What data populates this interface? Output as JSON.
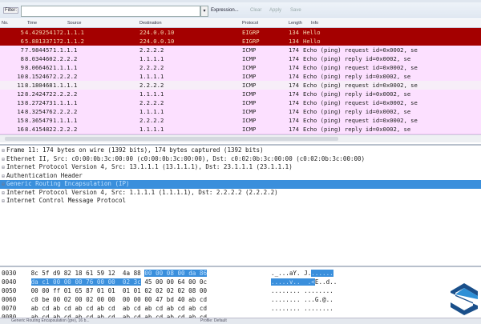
{
  "toolbar": {
    "filter_label": "Filter:",
    "filter_value": "",
    "expression": "Expression...",
    "clear": "Clear",
    "apply": "Apply",
    "save": "Save"
  },
  "columns": {
    "no": "No.",
    "time": "Time",
    "source": "Source",
    "destination": "Destination",
    "protocol": "Protocol",
    "length": "Length",
    "info": "Info"
  },
  "packets": [
    {
      "no": "5",
      "time": "4.429254",
      "src": "172.1.1.1",
      "dst": "224.0.0.10",
      "proto": "EIGRP",
      "len": "134",
      "info": "Hello",
      "type": "eigrp"
    },
    {
      "no": "6",
      "time": "5.881337",
      "src": "172.1.1.2",
      "dst": "224.0.0.10",
      "proto": "EIGRP",
      "len": "134",
      "info": "Hello",
      "type": "eigrp"
    },
    {
      "no": "7",
      "time": "7.984457",
      "src": "1.1.1.1",
      "dst": "2.2.2.2",
      "proto": "ICMP",
      "len": "174",
      "info": "Echo (ping) request  id=0x0002, se",
      "type": "icmp"
    },
    {
      "no": "8",
      "time": "8.034460",
      "src": "2.2.2.2",
      "dst": "1.1.1.1",
      "proto": "ICMP",
      "len": "174",
      "info": "Echo (ping) reply    id=0x0002, se",
      "type": "icmp"
    },
    {
      "no": "9",
      "time": "8.066462",
      "src": "1.1.1.1",
      "dst": "2.2.2.2",
      "proto": "ICMP",
      "len": "174",
      "info": "Echo (ping) request  id=0x0002, se",
      "type": "icmp"
    },
    {
      "no": "10",
      "time": "8.152467",
      "src": "2.2.2.2",
      "dst": "1.1.1.1",
      "proto": "ICMP",
      "len": "174",
      "info": "Echo (ping) reply    id=0x0002, se",
      "type": "icmp"
    },
    {
      "no": "11",
      "time": "8.180468",
      "src": "1.1.1.1",
      "dst": "2.2.2.2",
      "proto": "ICMP",
      "len": "174",
      "info": "Echo (ping) request  id=0x0002, se",
      "type": "sel"
    },
    {
      "no": "12",
      "time": "8.242472",
      "src": "2.2.2.2",
      "dst": "1.1.1.1",
      "proto": "ICMP",
      "len": "174",
      "info": "Echo (ping) reply    id=0x0002, se",
      "type": "icmp"
    },
    {
      "no": "13",
      "time": "8.272473",
      "src": "1.1.1.1",
      "dst": "2.2.2.2",
      "proto": "ICMP",
      "len": "174",
      "info": "Echo (ping) request  id=0x0002, se",
      "type": "icmp"
    },
    {
      "no": "14",
      "time": "8.325476",
      "src": "2.2.2.2",
      "dst": "1.1.1.1",
      "proto": "ICMP",
      "len": "174",
      "info": "Echo (ping) reply    id=0x0002, se",
      "type": "icmp"
    },
    {
      "no": "15",
      "time": "8.365479",
      "src": "1.1.1.1",
      "dst": "2.2.2.2",
      "proto": "ICMP",
      "len": "174",
      "info": "Echo (ping) request  id=0x0002, se",
      "type": "icmp"
    },
    {
      "no": "16",
      "time": "8.415482",
      "src": "2.2.2.2",
      "dst": "1.1.1.1",
      "proto": "ICMP",
      "len": "174",
      "info": "Echo (ping) reply    id=0x0002, se",
      "type": "icmp"
    }
  ],
  "details": [
    "Frame 11: 174 bytes on wire (1392 bits), 174 bytes captured (1392 bits)",
    "Ethernet II, Src: c0:00:0b:3c:00:00 (c0:00:0b:3c:00:00), Dst: c0:02:0b:3c:00:00 (c0:02:0b:3c:00:00)",
    "Internet Protocol Version 4, Src: 13.1.1.1 (13.1.1.1), Dst: 23.1.1.1 (23.1.1.1)",
    "Authentication Header",
    "Generic Routing Encapsulation (IP)",
    "Internet Protocol Version 4, Src: 1.1.1.1 (1.1.1.1), Dst: 2.2.2.2 (2.2.2.2)",
    "Internet Control Message Protocol"
  ],
  "selected_detail": 4,
  "hex": [
    {
      "off": "0030",
      "a": "8c 5f d9 82 18 61 59 12  4a 88 ",
      "h1": "00 00 08 00 da 86",
      "ascii_a": "._...aY. J.",
      "ascii_h": "......"
    },
    {
      "off": "0040",
      "h0": "da c1 00 00 00 76 00 00  02 3c",
      "b": " 45 00 00 64 00 0c",
      "ascii_h0": ".....v..  .<",
      "ascii_b": "E..d.."
    },
    {
      "off": "0050",
      "b": "00 00 ff 01 65 87 01 01  01 01 02 02 02 02 08 00",
      "ascii_b": "........ ........"
    },
    {
      "off": "0060",
      "b": "c0 be 00 02 00 02 00 00  00 00 00 47 bd 40 ab cd",
      "ascii_b": "........ ...G.@.."
    },
    {
      "off": "0070",
      "b": "ab cd ab cd ab cd ab cd  ab cd ab cd ab cd ab cd",
      "ascii_b": "........ ........"
    },
    {
      "off": "0080",
      "b": "ab cd ab cd ab cd ab cd  ab cd ab cd ab cd ab cd",
      "ascii_b": "........ ........"
    }
  ],
  "status": {
    "left": "Generic Routing Encapsulation (gre), 16 b...",
    "right": "Profile: Default"
  },
  "colors": {
    "eigrp": "#a40000",
    "icmp": "#fce0ff",
    "selection": "#3a8fdc"
  }
}
